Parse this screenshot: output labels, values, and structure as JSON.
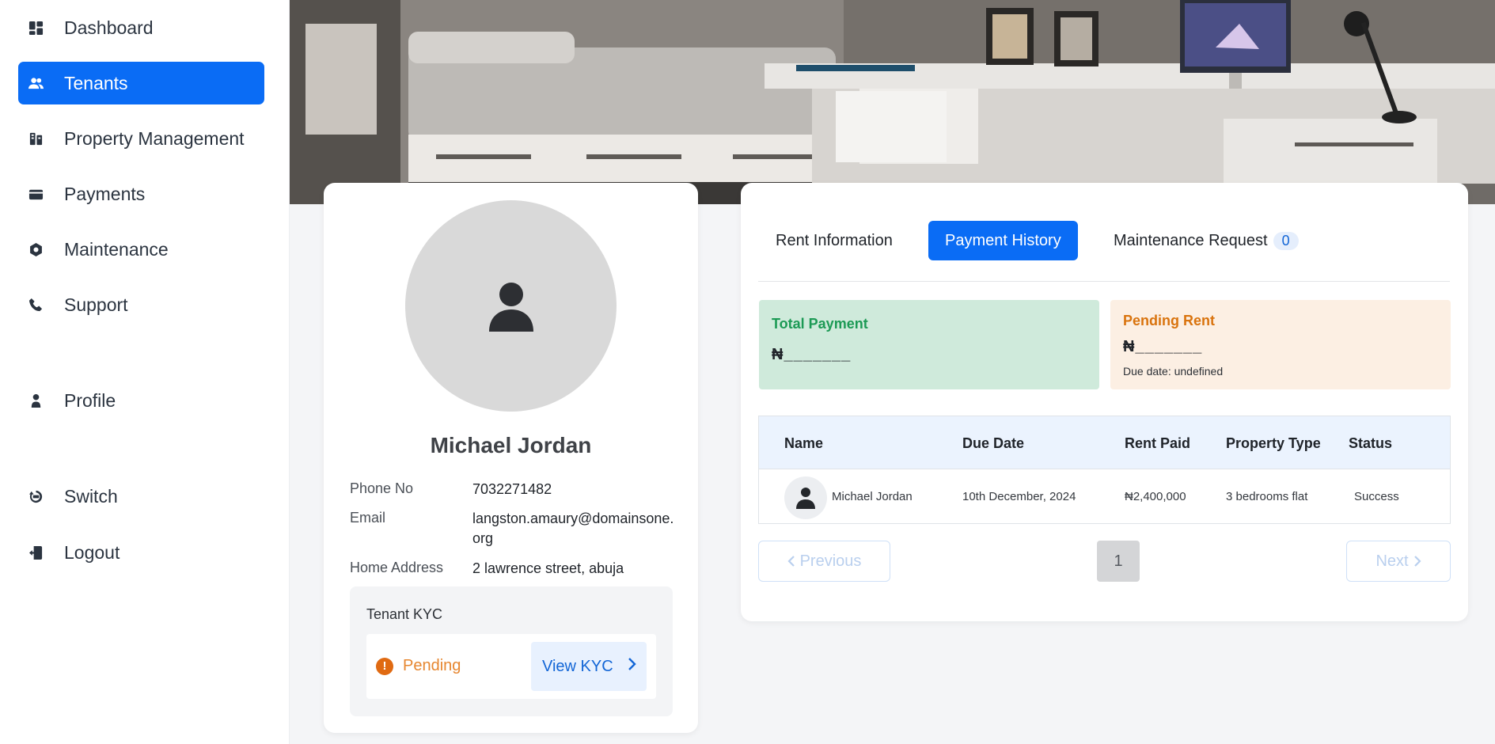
{
  "sidebar": {
    "items": [
      {
        "label": "Dashboard",
        "icon": "dashboard-icon"
      },
      {
        "label": "Tenants",
        "icon": "tenants-icon"
      },
      {
        "label": "Property Management",
        "icon": "property-icon"
      },
      {
        "label": "Payments",
        "icon": "wallet-icon"
      },
      {
        "label": "Maintenance",
        "icon": "gear-icon"
      },
      {
        "label": "Support",
        "icon": "phone-icon"
      },
      {
        "label": "Profile",
        "icon": "person-icon"
      },
      {
        "label": "Switch",
        "icon": "switch-icon"
      },
      {
        "label": "Logout",
        "icon": "logout-icon"
      }
    ],
    "active": "Tenants"
  },
  "profile": {
    "name": "Michael Jordan",
    "phone_label": "Phone No",
    "phone": "7032271482",
    "email_label": "Email",
    "email": "langston.amaury@domainsone.org",
    "address_label": "Home Address",
    "address": "2 lawrence street, abuja",
    "kyc_title": "Tenant KYC",
    "kyc_status": "Pending",
    "kyc_button": "View KYC"
  },
  "tabs": [
    {
      "label": "Rent Information"
    },
    {
      "label": "Payment History",
      "active": true
    },
    {
      "label": "Maintenance Request",
      "count": "0"
    }
  ],
  "stats": {
    "total": {
      "title": "Total Payment",
      "value": "₦_______"
    },
    "pending": {
      "title": "Pending Rent",
      "value": "₦_______",
      "due": "Due date: undefined"
    }
  },
  "table": {
    "headers": [
      "Name",
      "Due Date",
      "Rent Paid",
      "Property Type",
      "Status"
    ],
    "rows": [
      {
        "name": "Michael Jordan",
        "due_date": "10th December, 2024",
        "rent_paid": "₦2,400,000",
        "property_type": "3 bedrooms flat",
        "status": "Success"
      }
    ]
  },
  "pagination": {
    "previous": "Previous",
    "page": "1",
    "next": "Next"
  },
  "colors": {
    "accent": "#0a6cf5",
    "total_bg": "#cfeadb",
    "total_title": "#1c9a55",
    "pending_bg": "#fcefe3",
    "pending_title": "#d9730d",
    "kyc_pending": "#e6862f"
  }
}
